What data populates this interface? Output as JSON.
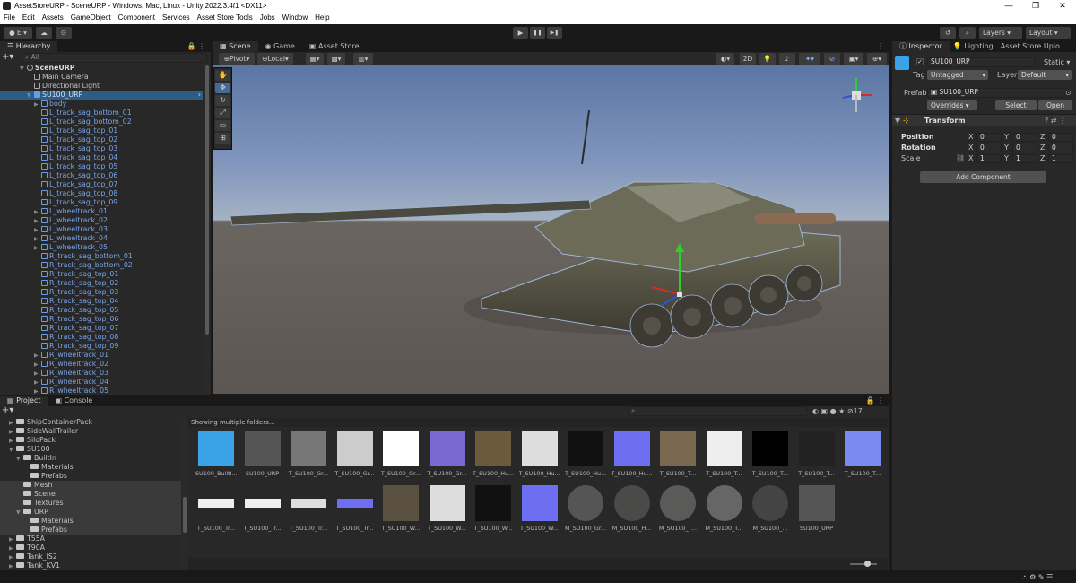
{
  "window": {
    "title": "AssetStoreURP - SceneURP - Windows, Mac, Linux - Unity 2022.3.4f1 <DX11>",
    "min": "—",
    "max": "❐",
    "close": "✕"
  },
  "menu": [
    "File",
    "Edit",
    "Assets",
    "GameObject",
    "Component",
    "Services",
    "Asset Store Tools",
    "Jobs",
    "Window",
    "Help"
  ],
  "toolbar": {
    "account": "E",
    "layers": "Layers",
    "layout": "Layout",
    "play": "▶",
    "pause": "❚❚",
    "step": "▶❚"
  },
  "hierarchy": {
    "tab": "Hierarchy",
    "search_placeholder": "All",
    "scene": "SceneURP",
    "root_items": [
      "Main Camera",
      "Directional Light"
    ],
    "prefab": "SU100_URP",
    "children": [
      "body",
      "L_track_sag_bottom_01",
      "L_track_sag_bottom_02",
      "L_track_sag_top_01",
      "L_track_sag_top_02",
      "L_track_sag_top_03",
      "L_track_sag_top_04",
      "L_track_sag_top_05",
      "L_track_sag_top_06",
      "L_track_sag_top_07",
      "L_track_sag_top_08",
      "L_track_sag_top_09",
      "L_wheeltrack_01",
      "L_wheeltrack_02",
      "L_wheeltrack_03",
      "L_wheeltrack_04",
      "L_wheeltrack_05",
      "R_track_sag_bottom_01",
      "R_track_sag_bottom_02",
      "R_track_sag_top_01",
      "R_track_sag_top_02",
      "R_track_sag_top_03",
      "R_track_sag_top_04",
      "R_track_sag_top_05",
      "R_track_sag_top_06",
      "R_track_sag_top_07",
      "R_track_sag_top_08",
      "R_track_sag_top_09",
      "R_wheeltrack_01",
      "R_wheeltrack_02",
      "R_wheeltrack_03",
      "R_wheeltrack_04",
      "R_wheeltrack_05"
    ]
  },
  "scene_tabs": [
    "Scene",
    "Game",
    "Asset Store"
  ],
  "scene_toolbar": {
    "pivot": "Pivot",
    "local": "Local",
    "mode2d": "2D"
  },
  "inspector": {
    "tabs": [
      "Inspector",
      "Lighting",
      "Asset Store Uplo"
    ],
    "object_name": "SU100_URP",
    "static_label": "Static",
    "tag_label": "Tag",
    "tag_value": "Untagged",
    "layer_label": "Layer",
    "layer_value": "Default",
    "prefab_label": "Prefab",
    "prefab_value": "SU100_URP",
    "overrides": "Overrides",
    "select": "Select",
    "open": "Open",
    "component": "Transform",
    "position": {
      "label": "Position",
      "x": "0",
      "y": "0",
      "z": "0"
    },
    "rotation": {
      "label": "Rotation",
      "x": "0",
      "y": "0",
      "z": "0"
    },
    "scale": {
      "label": "Scale",
      "x": "1",
      "y": "1",
      "z": "1"
    },
    "add_component": "Add Component"
  },
  "project": {
    "tabs": [
      "Project",
      "Console"
    ],
    "info": "Showing multiple folders...",
    "hidden_count": "17",
    "tree": [
      {
        "label": "ShipContainerPack",
        "depth": 1
      },
      {
        "label": "SideWallTrailer",
        "depth": 1
      },
      {
        "label": "SiloPack",
        "depth": 1
      },
      {
        "label": "SU100",
        "depth": 1
      },
      {
        "label": "BuiltIn",
        "depth": 2
      },
      {
        "label": "Materials",
        "depth": 3
      },
      {
        "label": "Prefabs",
        "depth": 3
      },
      {
        "label": "Mesh",
        "depth": 2
      },
      {
        "label": "Scene",
        "depth": 2
      },
      {
        "label": "Textures",
        "depth": 2
      },
      {
        "label": "URP",
        "depth": 2
      },
      {
        "label": "Materials",
        "depth": 3
      },
      {
        "label": "Prefabs",
        "depth": 3
      },
      {
        "label": "T55A",
        "depth": 1
      },
      {
        "label": "T90A",
        "depth": 1
      },
      {
        "label": "Tank_IS2",
        "depth": 1
      },
      {
        "label": "Tank_KV1",
        "depth": 1
      }
    ],
    "assets_row1": [
      "SU100_BuiltI...",
      "SU100_URP",
      "T_SU100_Gr...",
      "T_SU100_Gr...",
      "T_SU100_Gr...",
      "T_SU100_Gr...",
      "T_SU100_Hu...",
      "T_SU100_Hu...",
      "T_SU100_Hu...",
      "T_SU100_Hu...",
      "T_SU100_T...",
      "T_SU100_T...",
      "T_SU100_T...",
      "T_SU100_T...",
      "T_SU100_T..."
    ],
    "assets_row2": [
      "T_SU100_Tr...",
      "T_SU100_Tr...",
      "T_SU100_Tr...",
      "T_SU100_Tr...",
      "T_SU100_W...",
      "T_SU100_W...",
      "T_SU100_W...",
      "T_SU100_W...",
      "M_SU100_Gr...",
      "M_SU100_H...",
      "M_SU100_T...",
      "M_SU100_T...",
      "M_SU100_...",
      "SU100_URP"
    ]
  },
  "colors": {
    "accent": "#3a5f99",
    "selected": "#2c5d87",
    "link": "#7aa4e8"
  }
}
